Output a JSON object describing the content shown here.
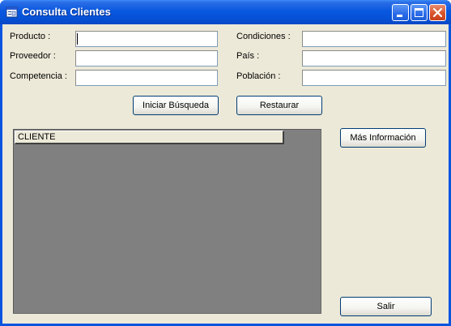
{
  "window": {
    "title": "Consulta Clientes",
    "app_icon": "form-app-icon",
    "title_color": "#0a58e0"
  },
  "form": {
    "left_labels": [
      "Producto :",
      "Proveedor :",
      "Competencia :"
    ],
    "right_labels": [
      "Condiciones :",
      "País :",
      "Población :"
    ],
    "producto_value": "",
    "proveedor_value": "",
    "competencia_value": "",
    "condiciones_value": "",
    "pais_value": "",
    "poblacion_value": ""
  },
  "buttons": {
    "search": "Iniciar Búsqueda",
    "reset": "Restaurar",
    "more_info": "Más Información",
    "exit": "Salir"
  },
  "grid": {
    "columns": [
      "CLIENTE"
    ],
    "rows": [],
    "background": "#808080"
  }
}
